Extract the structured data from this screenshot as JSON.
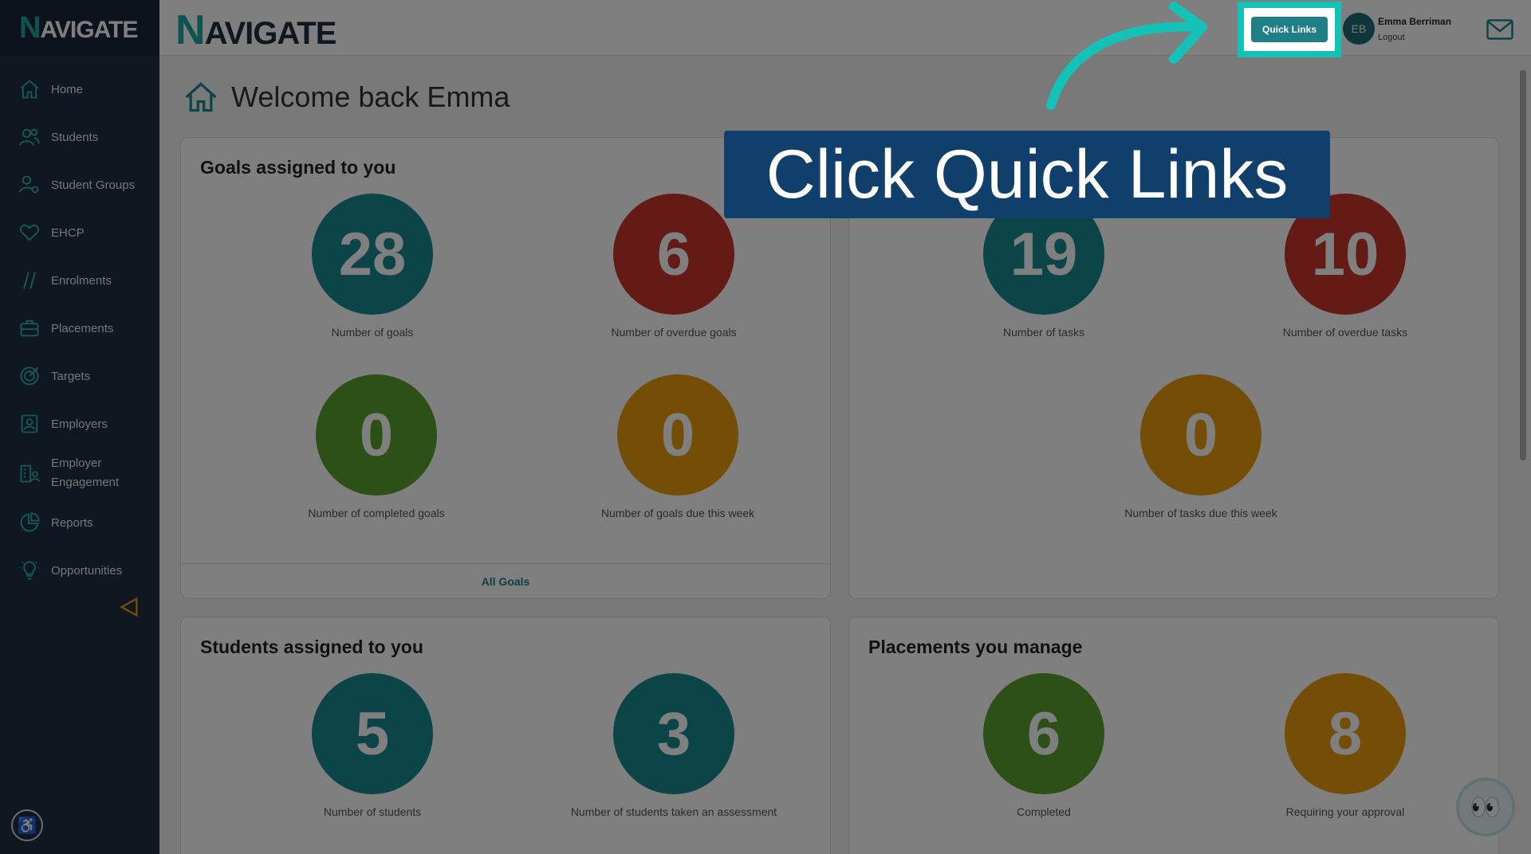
{
  "brand": {
    "logo_n": "N",
    "logo_rest": "AVIGATE",
    "accent": "#1aa6a0"
  },
  "sidebar": {
    "items": [
      {
        "label": "Home",
        "icon": "home-icon"
      },
      {
        "label": "Students",
        "icon": "users-icon"
      },
      {
        "label": "Student Groups",
        "icon": "user-group-icon"
      },
      {
        "label": "EHCP",
        "icon": "heart-icon"
      },
      {
        "label": "Enrolments",
        "icon": "enrolments-icon"
      },
      {
        "label": "Placements",
        "icon": "briefcase-icon"
      },
      {
        "label": "Targets",
        "icon": "target-icon"
      },
      {
        "label": "Employers",
        "icon": "employer-icon"
      },
      {
        "label": "Employer Engagement",
        "icon": "building-icon"
      },
      {
        "label": "Reports",
        "icon": "pie-chart-icon"
      },
      {
        "label": "Opportunities",
        "icon": "lightbulb-icon"
      }
    ]
  },
  "header": {
    "quick_links": "Quick Links",
    "user_initials": "EB",
    "user_name": "Emma Berriman",
    "logout": "Logout"
  },
  "page": {
    "title": "Welcome back Emma"
  },
  "cards": {
    "goals": {
      "title": "Goals assigned to you",
      "stats": [
        {
          "value": "28",
          "label": "Number of goals",
          "color": "#178a90"
        },
        {
          "value": "6",
          "label": "Number of overdue goals",
          "color": "#c8372b"
        },
        {
          "value": "0",
          "label": "Number of completed goals",
          "color": "#5aa02c"
        },
        {
          "value": "0",
          "label": "Number of goals due this week",
          "color": "#e89a0c"
        }
      ],
      "footer": "All Goals"
    },
    "tasks": {
      "stats": [
        {
          "value": "19",
          "label": "Number of tasks",
          "color": "#178a90"
        },
        {
          "value": "10",
          "label": "Number of overdue tasks",
          "color": "#c8372b"
        },
        {
          "value": "0",
          "label": "Number of tasks due this week",
          "color": "#e89a0c"
        }
      ]
    },
    "students": {
      "title": "Students assigned to you",
      "stats": [
        {
          "value": "5",
          "label": "Number of students",
          "color": "#178a90"
        },
        {
          "value": "3",
          "label": "Number of students taken an assessment",
          "color": "#178a90"
        }
      ]
    },
    "placements": {
      "title": "Placements you manage",
      "stats": [
        {
          "value": "6",
          "label": "Completed",
          "color": "#5aa02c"
        },
        {
          "value": "8",
          "label": "Requiring your approval",
          "color": "#e89a0c"
        }
      ]
    }
  },
  "overlay": {
    "callout": "Click Quick Links",
    "highlight_color": "#14c3b7",
    "callout_bg": "#0f3f6a"
  }
}
